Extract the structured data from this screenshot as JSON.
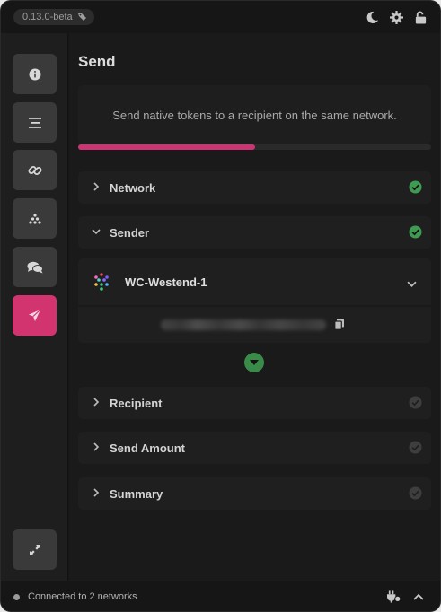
{
  "app": {
    "version": "0.13.0-beta"
  },
  "page": {
    "title": "Send",
    "description": "Send native tokens to a recipient on the same network.",
    "progress_fraction": 0.5
  },
  "sections": {
    "network": {
      "label": "Network",
      "status": "complete"
    },
    "sender": {
      "label": "Sender",
      "status": "complete"
    },
    "recipient": {
      "label": "Recipient",
      "status": "incomplete"
    },
    "send_amount": {
      "label": "Send Amount",
      "status": "incomplete"
    },
    "summary": {
      "label": "Summary",
      "status": "incomplete"
    }
  },
  "sender": {
    "account_name": "WC-Westend-1"
  },
  "footer": {
    "status": "Connected to 2 networks"
  },
  "colors": {
    "accent": "#cc3574",
    "success": "#3a8a4a",
    "background": "#161616"
  },
  "icons": {
    "top": [
      "moon-icon",
      "gear-icon",
      "unlock-icon"
    ],
    "sidebar": [
      "info-icon",
      "list-icon",
      "link-icon",
      "dots-icon",
      "chat-icon",
      "send-icon",
      "expand-icon"
    ],
    "footer": [
      "plug-icon",
      "chevron-up-icon"
    ]
  }
}
